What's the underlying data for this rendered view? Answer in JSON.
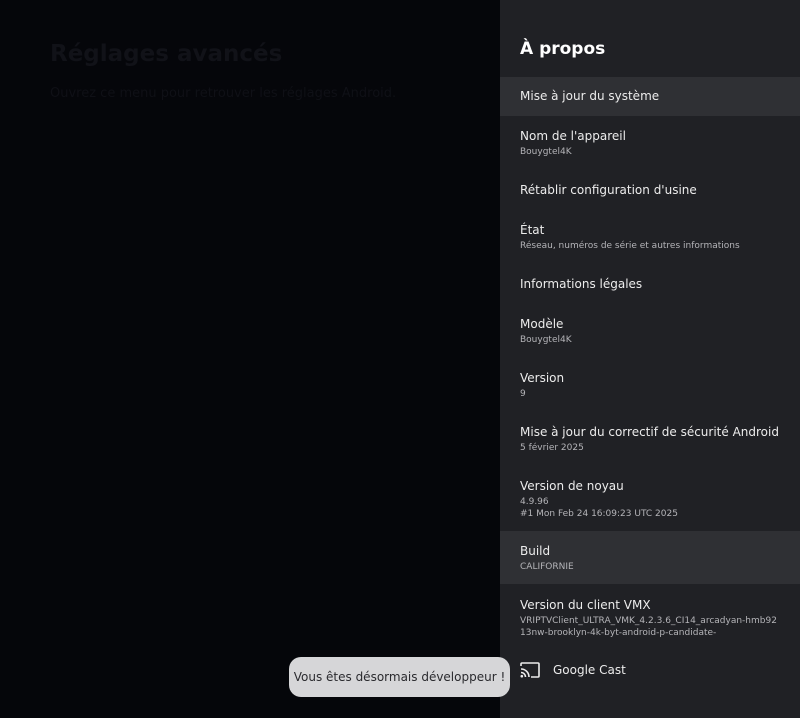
{
  "background": {
    "title": "Réglages avancés",
    "subtitle": "Ouvrez ce menu pour retrouver les réglages Android."
  },
  "panel": {
    "title": "À propos",
    "items": [
      {
        "label": "Mise à jour du système",
        "highlighted": true
      },
      {
        "label": "Nom de l'appareil",
        "value": "Bouygtel4K"
      },
      {
        "label": "Rétablir configuration d'usine"
      },
      {
        "label": "État",
        "value": "Réseau, numéros de série et autres informations"
      },
      {
        "label": "Informations légales"
      },
      {
        "label": "Modèle",
        "value": "Bouygtel4K"
      },
      {
        "label": "Version",
        "value": "9"
      },
      {
        "label": "Mise à jour du correctif de sécurité Android",
        "value": "5 février 2025"
      },
      {
        "label": "Version de noyau",
        "value": "4.9.96",
        "value2": "#1 Mon Feb 24 16:09:23 UTC 2025"
      },
      {
        "label": "Build",
        "value": "CALIFORNIE",
        "highlighted": true
      },
      {
        "label": "Version du client VMX",
        "value": "VRIPTVClient_ULTRA_VMK_4.2.3.6_CI14_arcadyan-hmb92",
        "value2": "13nw-brooklyn-4k-byt-android-p-candidate-"
      },
      {
        "label": "Google Cast",
        "icon": "cast-icon"
      }
    ]
  },
  "toast": {
    "message": "Vous êtes désormais développeur !"
  },
  "colors": {
    "panel_bg": "#202125",
    "highlight_bg": "#2f3034",
    "toast_bg": "#d6d6d8"
  }
}
